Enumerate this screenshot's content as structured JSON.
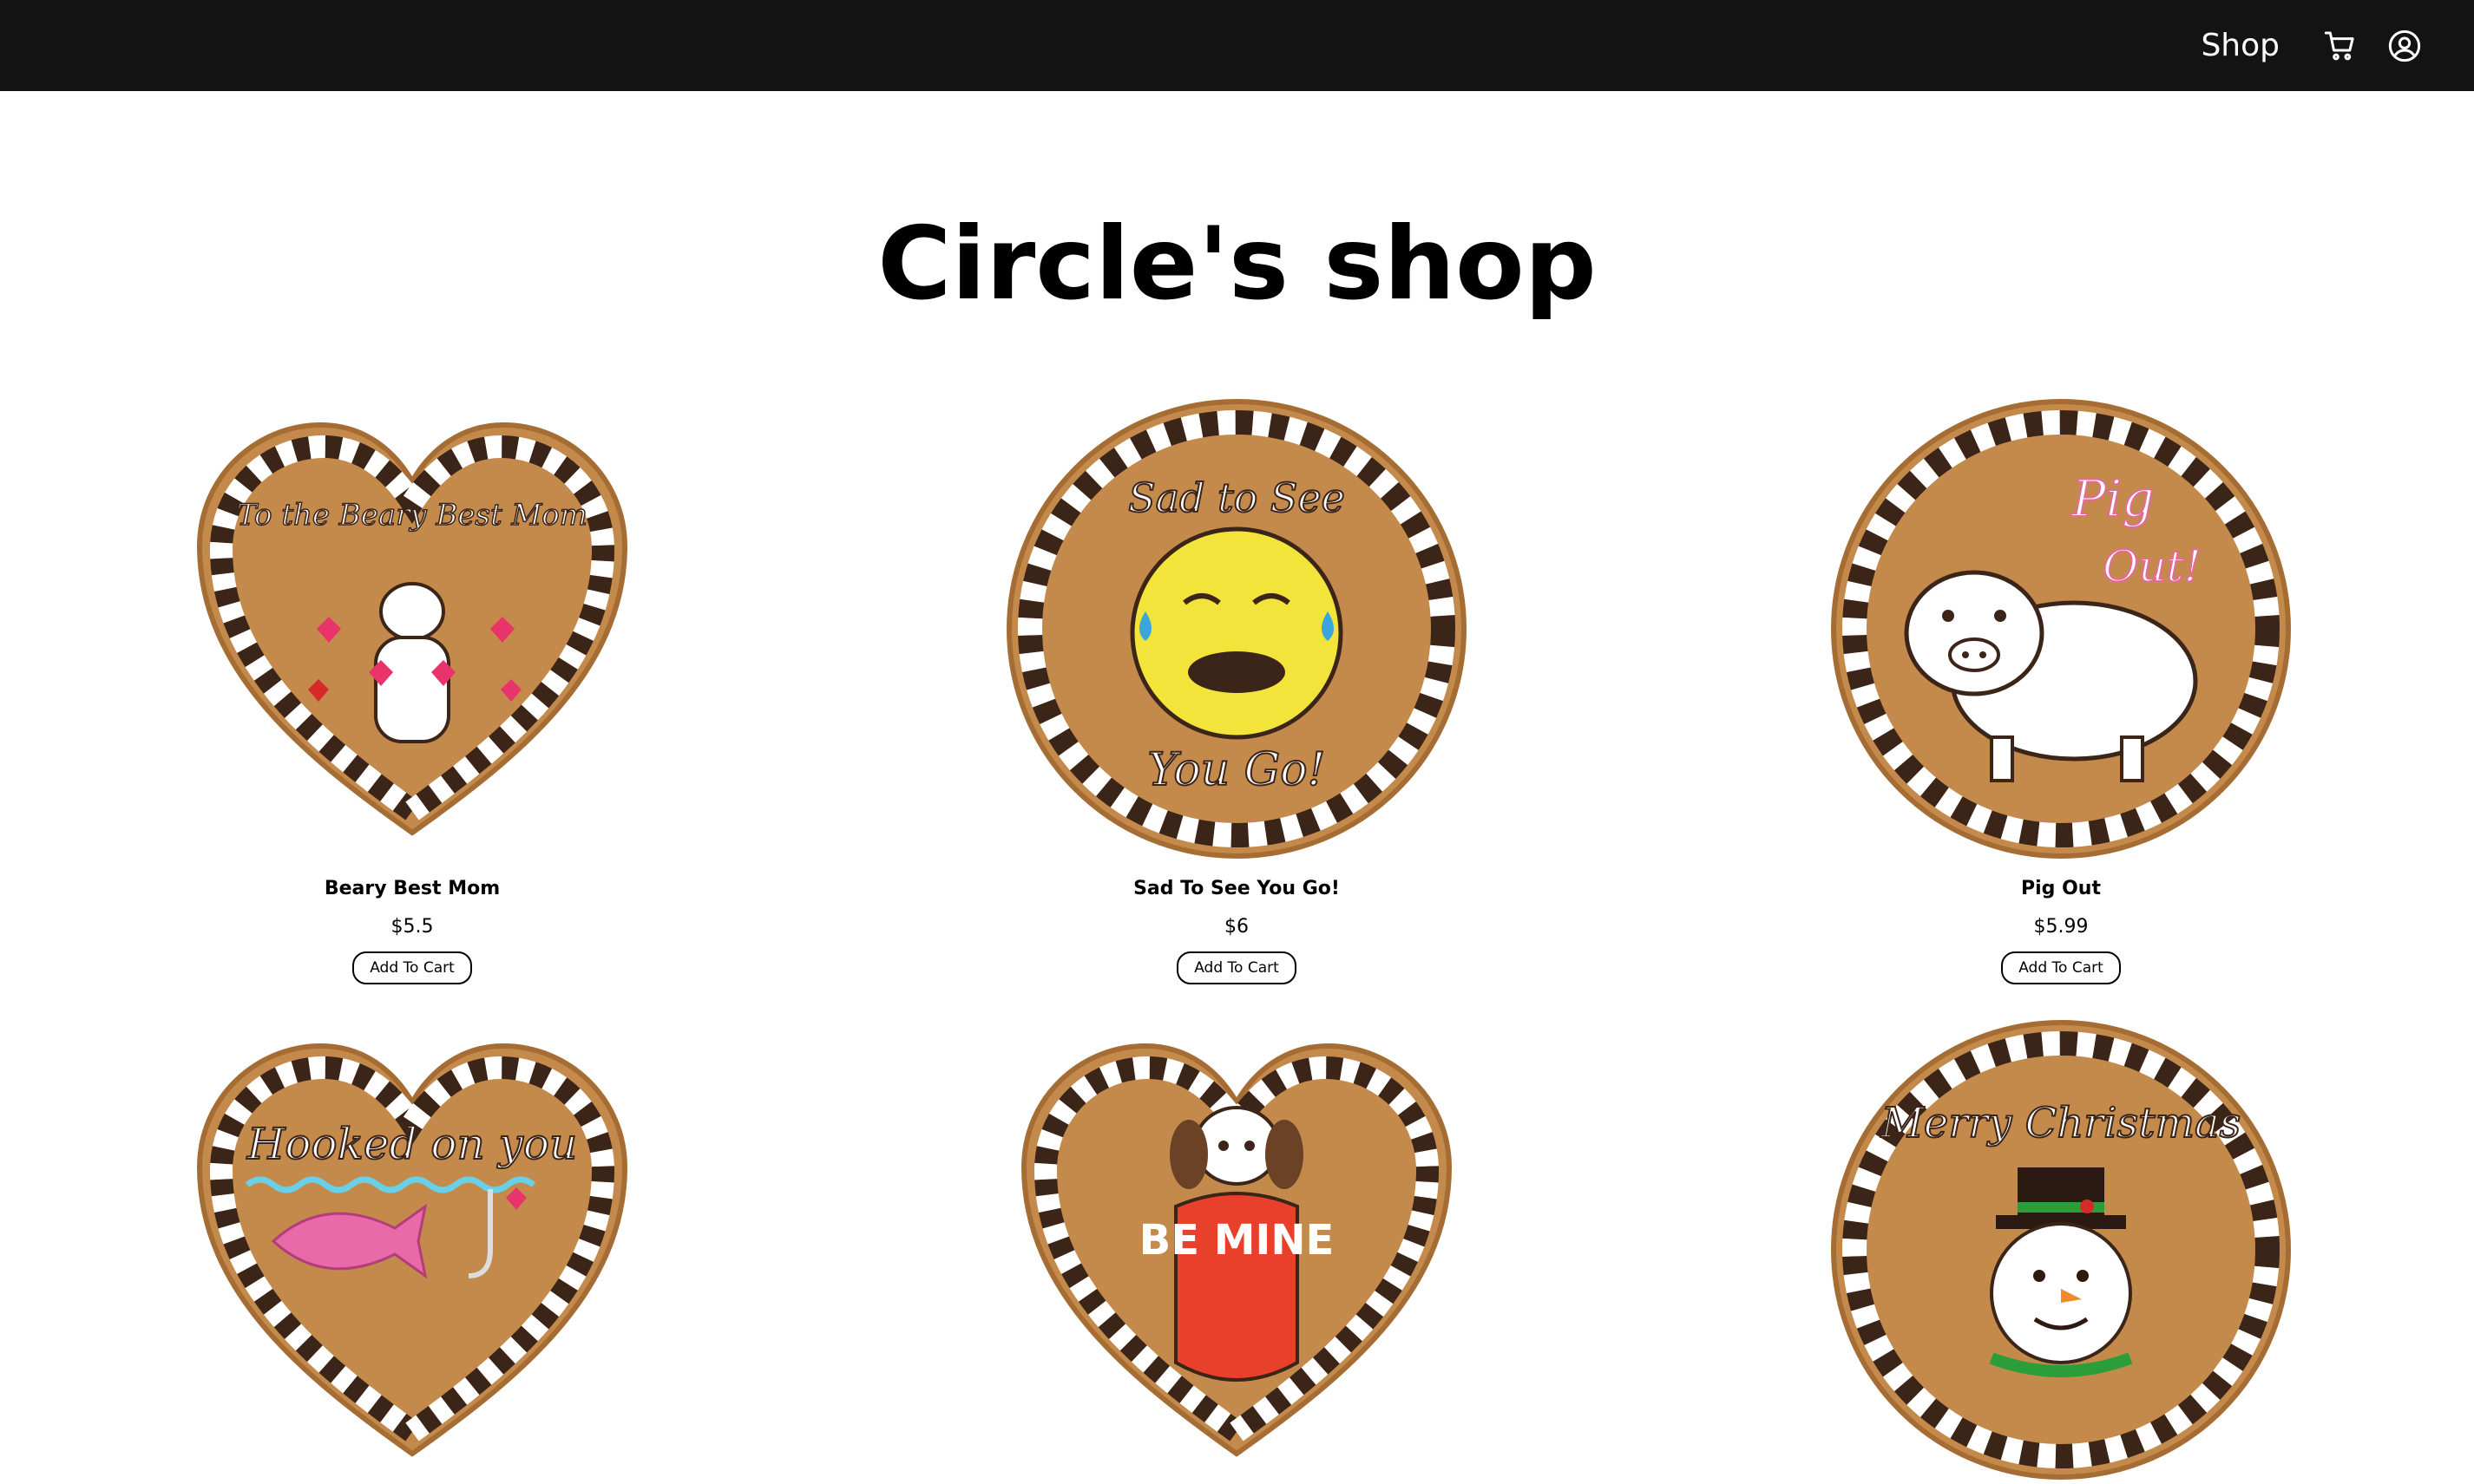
{
  "nav": {
    "shop_label": "Shop",
    "cart_icon": "cart-icon",
    "account_icon": "user-circle-icon"
  },
  "page": {
    "title": "Circle's shop"
  },
  "colors": {
    "navbar": "#131313",
    "cookie_dough": "#c48a4c",
    "cookie_dough_dark": "#a56d33",
    "chocolate_frosting": "#3b2418",
    "white_frosting": "#ffffff"
  },
  "products": [
    {
      "name": "Beary Best Mom",
      "price": "$5.5",
      "button": "Add To Cart",
      "shape": "heart",
      "text": "To the Beary Best Mom"
    },
    {
      "name": "Sad To See You Go!",
      "price": "$6",
      "button": "Add To Cart",
      "shape": "circle",
      "text": "Sad to See You Go!"
    },
    {
      "name": "Pig Out",
      "price": "$5.99",
      "button": "Add To Cart",
      "shape": "circle",
      "text": "Pig Out!"
    },
    {
      "name": "",
      "price": "",
      "button": "",
      "shape": "heart",
      "text": "Hooked on you"
    },
    {
      "name": "",
      "price": "",
      "button": "",
      "shape": "heart",
      "text": "BE MINE"
    },
    {
      "name": "",
      "price": "",
      "button": "",
      "shape": "circle",
      "text": "Merry Christmas"
    }
  ]
}
